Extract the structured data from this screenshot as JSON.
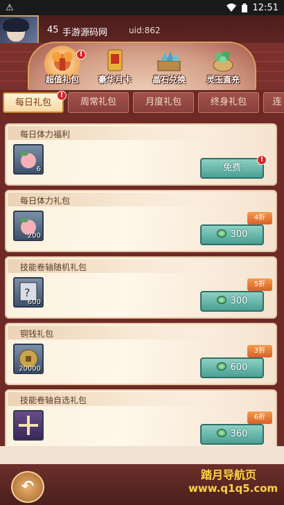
{
  "status_bar": {
    "time": "12:51",
    "warning_icon": "warning-icon"
  },
  "player": {
    "level": "45",
    "name": "手游源码网",
    "uid": "uid:862"
  },
  "top_nav": [
    {
      "label": "超值礼包",
      "icon": "gift-bag-icon"
    },
    {
      "label": "豪华月卡",
      "icon": "month-card-icon"
    },
    {
      "label": "晶石兑换",
      "icon": "crystal-exchange-icon"
    },
    {
      "label": "灵玉直充",
      "icon": "jade-recharge-icon"
    }
  ],
  "tabs": [
    "每日礼包",
    "周常礼包",
    "月度礼包",
    "终身礼包",
    "连"
  ],
  "packs": [
    {
      "title": "每日体力福利",
      "item_qty": "6",
      "price": "免费",
      "discount": ""
    },
    {
      "title": "每日体力礼包",
      "item_qty": "200",
      "price": "300",
      "discount": "4折"
    },
    {
      "title": "技能卷轴随机礼包",
      "item_qty": "600",
      "price": "300",
      "discount": "5折"
    },
    {
      "title": "铜钱礼包",
      "item_qty": "20000",
      "price": "600",
      "discount": "3折"
    },
    {
      "title": "技能卷轴自选礼包",
      "item_qty": "",
      "price": "360",
      "discount": "6折"
    }
  ],
  "watermark": {
    "line1": "踏月导航页",
    "line2": "www.q1q5.com"
  },
  "colors": {
    "accent_red": "#7a2c2a",
    "button_teal": "#4aa094",
    "discount_orange": "#e07a35"
  }
}
